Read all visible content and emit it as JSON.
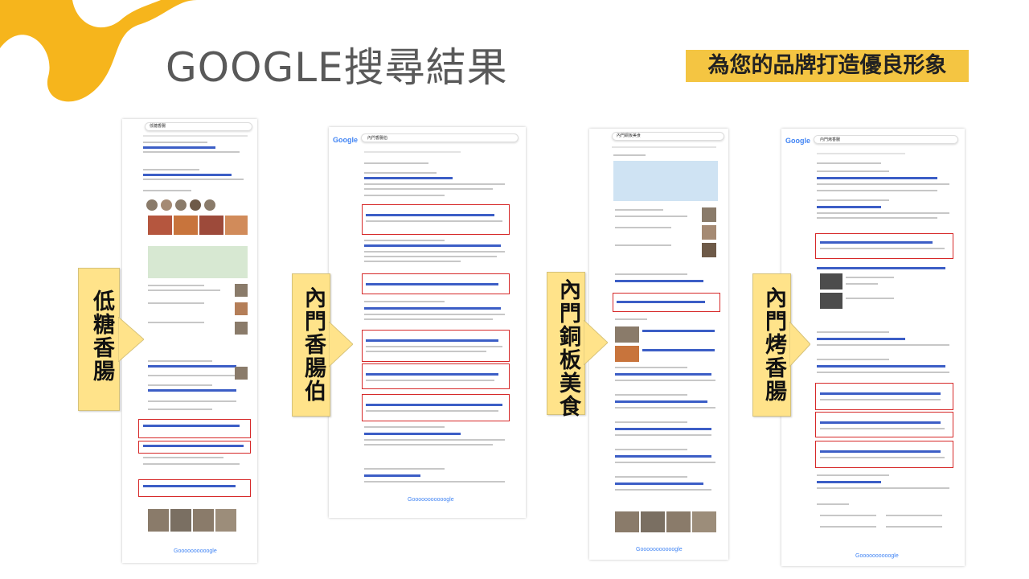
{
  "slide": {
    "title": "GOOGLE搜尋結果",
    "tagline": "為您的品牌打造優良形象"
  },
  "keywords": [
    {
      "label": "低糖香腸"
    },
    {
      "label": "內門香腸伯"
    },
    {
      "label": "內門銅板美食"
    },
    {
      "label": "內門烤香腸"
    }
  ],
  "shots": [
    {
      "search_query": "低糖香腸",
      "pager": "Goooooooooogle"
    },
    {
      "search_query": "內門香腸伯",
      "pager": "Gooooooooooogle"
    },
    {
      "search_query": "內門銅板美食",
      "pager": "Gooooooooooogle"
    },
    {
      "search_query": "內門烤香腸",
      "pager": "Goooooooooogle"
    }
  ],
  "colors": {
    "accent_yellow": "#f4c542",
    "label_fill": "#ffe38a",
    "highlight_red": "#d62828",
    "link_blue": "#3c5ec6"
  }
}
